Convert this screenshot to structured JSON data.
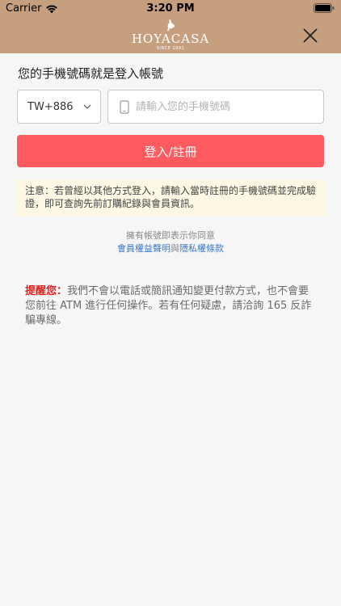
{
  "status_bar": {
    "carrier": "Carrier",
    "time": "3:20 PM"
  },
  "header": {
    "logo_text": "HOYACASA",
    "logo_sub": "SINCE 1991",
    "background_color": "#c69f7e"
  },
  "form": {
    "account_label": "您的手機號碼就是登入帳號",
    "country_code": "TW+886",
    "phone_placeholder": "請輸入您的手機號碼",
    "phone_value": "",
    "login_button": "登入/註冊"
  },
  "notice": {
    "text": "注意：若曾經以其他方式登入，請輸入當時註冊的手機號碼並完成驗證，即可查詢先前訂購紀錄與會員資訊。"
  },
  "agreement": {
    "prefix": "擁有帳號即表示你同意",
    "terms_link": "會員權益聲明",
    "and": "與",
    "privacy_link": "隱私權條款"
  },
  "reminder": {
    "title": "提醒您：",
    "text": "我們不會以電話或簡訊通知變更付款方式，也不會要您前往 ATM 進行任何操作。若有任何疑慮，請洽詢 165 反詐騙專線。"
  },
  "colors": {
    "accent": "#ff5a5f",
    "link": "#3b79c8",
    "warning": "#e0201c"
  }
}
